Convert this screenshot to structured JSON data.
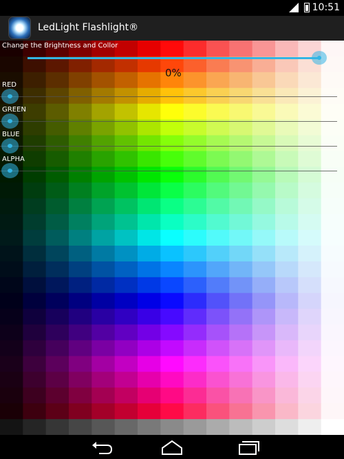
{
  "status_bar": {
    "time": "10:51"
  },
  "app": {
    "title": "LedLight Flashlight®"
  },
  "controls": {
    "brightness_label": "Change the Brightness and Collor",
    "brightness_percent_text": "0%",
    "brightness_value": 1.0,
    "channels": [
      {
        "label": "RED",
        "value": 0
      },
      {
        "label": "GREEN",
        "value": 0
      },
      {
        "label": "BLUE",
        "value": 0
      },
      {
        "label": "ALPHA",
        "value": 0
      }
    ]
  },
  "colors": {
    "accent": "#33b5e5",
    "action_bar": "#1f1f1f"
  },
  "icons": {
    "app": "flashlight-logo-icon",
    "back": "back-icon",
    "home": "home-icon",
    "recents": "recents-icon"
  }
}
